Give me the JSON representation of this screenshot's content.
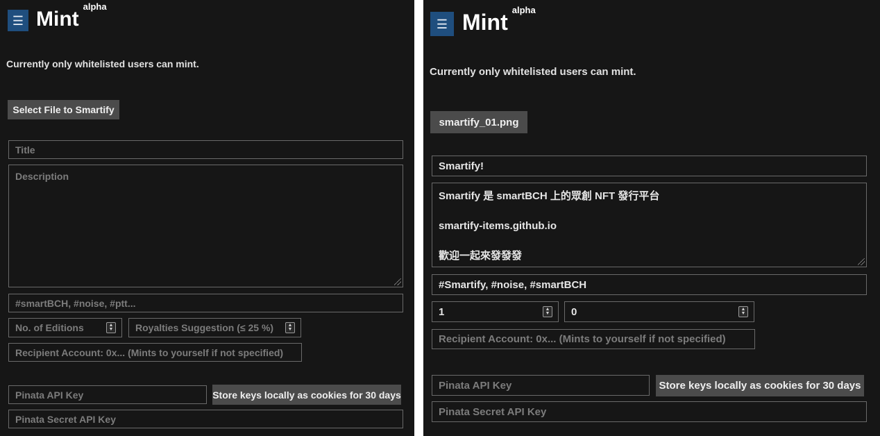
{
  "left": {
    "menu_icon": "☰",
    "title": "Mint",
    "title_badge": "alpha",
    "notice": "Currently only whitelisted users can mint.",
    "select_file_label": "Select File to Smartify",
    "title_placeholder": "Title",
    "description_placeholder": "Description",
    "tags_placeholder": "#smartBCH, #noise, #ptt...",
    "editions_placeholder": "No. of Editions",
    "royalties_placeholder": "Royalties Suggestion (≤ 25 %)",
    "recipient_placeholder": "Recipient Account: 0x... (Mints to yourself if not specified)",
    "pinata_key_placeholder": "Pinata API Key",
    "store_keys_label": "Store keys locally as cookies for 30 days",
    "pinata_secret_placeholder": "Pinata Secret API Key"
  },
  "right": {
    "menu_icon": "☰",
    "title": "Mint",
    "title_badge": "alpha",
    "notice": "Currently only whitelisted users can mint.",
    "file_label": "smartify_01.png",
    "title_value": "Smartify!",
    "description_lines": [
      "Smartify 是 smartBCH 上的眾創 NFT 發行平台",
      "smartify-items.github.io",
      "歡迎一起來發發發"
    ],
    "tags_value": "#Smartify, #noise, #smartBCH",
    "editions_value": "1",
    "royalties_value": "0",
    "recipient_placeholder": "Recipient Account: 0x... (Mints to yourself if not specified)",
    "pinata_key_placeholder": "Pinata API Key",
    "store_keys_label": "Store keys locally as cookies for 30 days",
    "pinata_secret_placeholder": "Pinata Secret API Key"
  },
  "spinner_up": "▲",
  "spinner_down": "▼",
  "colors": {
    "background": "#161616",
    "accent": "#1f4e7e",
    "button": "#4b4b4b",
    "border": "#6a6a6a"
  }
}
